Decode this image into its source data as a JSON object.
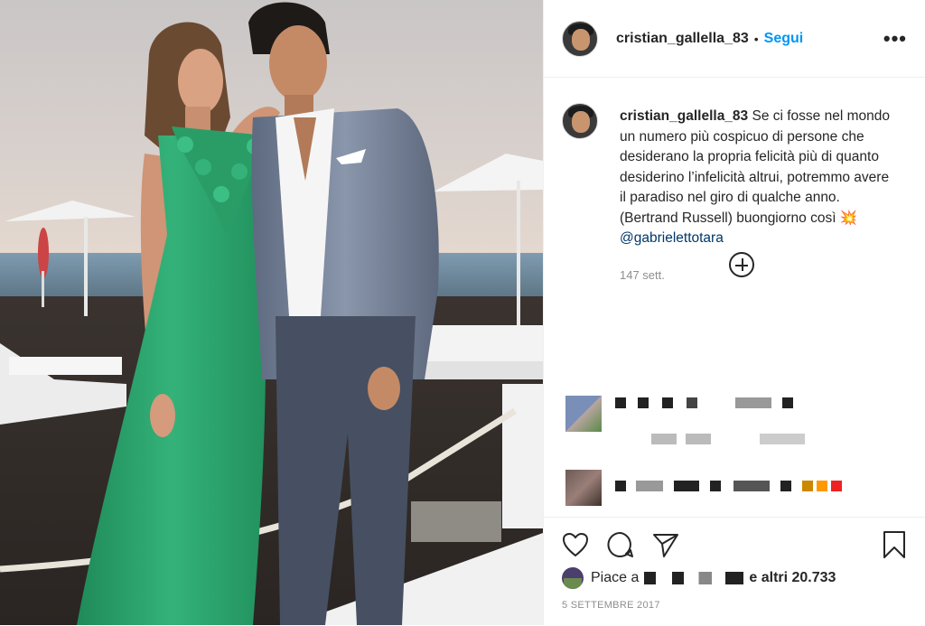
{
  "post": {
    "username": "cristian_gallella_83",
    "dot": "•",
    "follow_label": "Segui",
    "more_label": "•••",
    "caption_user": "cristian_gallella_83",
    "caption_text": "Se ci fosse nel mondo un numero più cospicuo di persone che desiderano la propria felicità più di quanto desiderino l’infelicità altrui, potremmo avere il paradiso nel giro di qualche anno. (Bertrand Russell) buongiorno così 💥",
    "mention": "@gabrielettotara",
    "time": "147 sett.",
    "likes_prefix": "Piace a",
    "likes_suffix": "e altri 20.733",
    "date": "5 SETTEMBRE 2017"
  },
  "icons": {
    "like": "heart-icon",
    "comment": "comment-icon",
    "share": "paper-plane-icon",
    "save": "bookmark-icon",
    "load_more": "plus-circle-icon"
  },
  "colors": {
    "follow": "#0095f6",
    "mention": "#00376b",
    "muted": "#8e8e8e",
    "dress": "#2fa36d"
  }
}
